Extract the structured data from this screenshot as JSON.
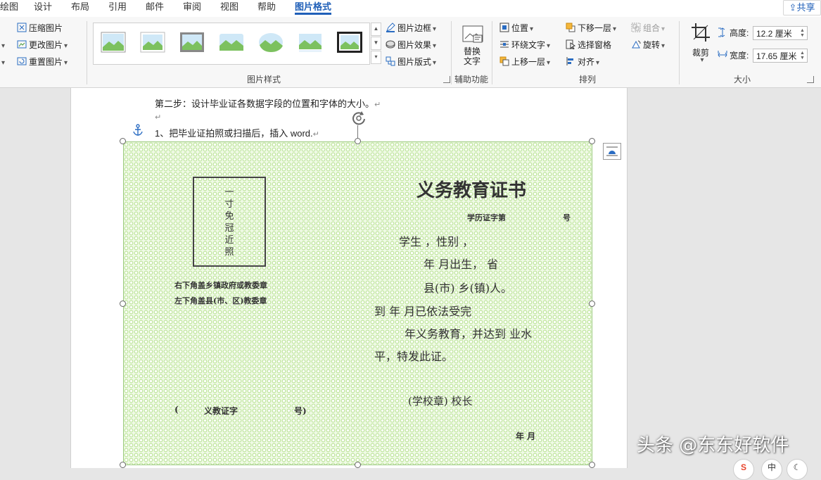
{
  "tabs": [
    "绘图",
    "设计",
    "布局",
    "引用",
    "邮件",
    "审阅",
    "视图",
    "帮助",
    "图片格式"
  ],
  "active_tab": "图片格式",
  "share": "共享",
  "ribbon": {
    "adjust": {
      "compress": "压缩图片",
      "change": "更改图片",
      "reset": "重置图片"
    },
    "styles": {
      "label": "图片样式",
      "border": "图片边框",
      "effects": "图片效果",
      "layout": "图片版式"
    },
    "accessibility": {
      "alt_text_line1": "替换",
      "alt_text_line2": "文字",
      "label": "辅助功能"
    },
    "arrange": {
      "position": "位置",
      "wrap": "环绕文字",
      "forward": "上移一层",
      "backward": "下移一层",
      "pane": "选择窗格",
      "align": "对齐",
      "group": "组合",
      "rotate": "旋转",
      "label": "排列"
    },
    "size": {
      "crop": "裁剪",
      "height_label": "高度:",
      "height_value": "12.2 厘米",
      "width_label": "宽度:",
      "width_value": "17.65 厘米",
      "label": "大小"
    }
  },
  "document": {
    "line1": "第二步：设计毕业证各数据字段的位置和字体的大小。",
    "line3": "1、把毕业证拍照或扫描后，插入 word."
  },
  "certificate": {
    "title": "义务教育证书",
    "photo_text": [
      "一",
      "寸",
      "免",
      "冠",
      "近",
      "照"
    ],
    "cert_no": "学历证字第",
    "hao": "号",
    "stamp1": "右下角盖乡镇政府或教委章",
    "stamp2": "左下角盖县(市、区)教委章",
    "body": [
      "学生            ，性别     ，",
      "年      月出生，          省",
      "县(市)                乡(镇)人。",
      "到              年          月已依法受完",
      "年义务教育，并达到       业水",
      "平，特发此证。"
    ],
    "school": "(学校章)          校长",
    "edu_no_left": "(",
    "edu_no_mid": "义教证字",
    "edu_no_right": "号)",
    "date": "年      月"
  },
  "watermark": "头条 @东东好软件",
  "tray": [
    "中"
  ],
  "colors": {
    "accent": "#1f5fb8",
    "ribbon_bg": "#f7f7f7",
    "cert_green": "#a0d76e"
  }
}
